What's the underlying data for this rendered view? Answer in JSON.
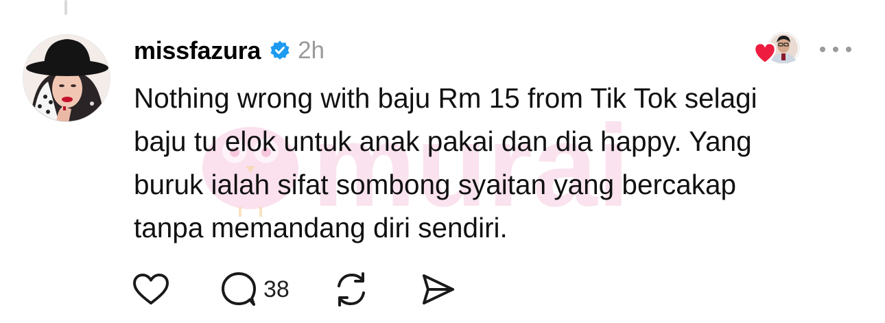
{
  "post": {
    "username": "missfazura",
    "verified": true,
    "timestamp": "2h",
    "body": "Nothing wrong with baju Rm 15 from Tik Tok selagi\nbaju tu elok untuk anak pakai dan dia happy. Yang\nburuk ialah sifat sombong syaitan yang bercakap\ntanpa memandang diri sendiri.",
    "reply_count": "38"
  },
  "watermark": {
    "text": "murai",
    "color": "#f6c9df"
  },
  "colors": {
    "verified_badge": "#1d9bf0",
    "timestamp": "#999999",
    "heart_reaction": "#ee1d40",
    "icon_stroke": "#1a1a1a"
  },
  "icons": {
    "verified": "verified-badge-icon",
    "more": "more-dots-icon",
    "like": "heart-icon",
    "reply": "comment-bubble-icon",
    "repost": "repost-icon",
    "share": "send-icon"
  }
}
